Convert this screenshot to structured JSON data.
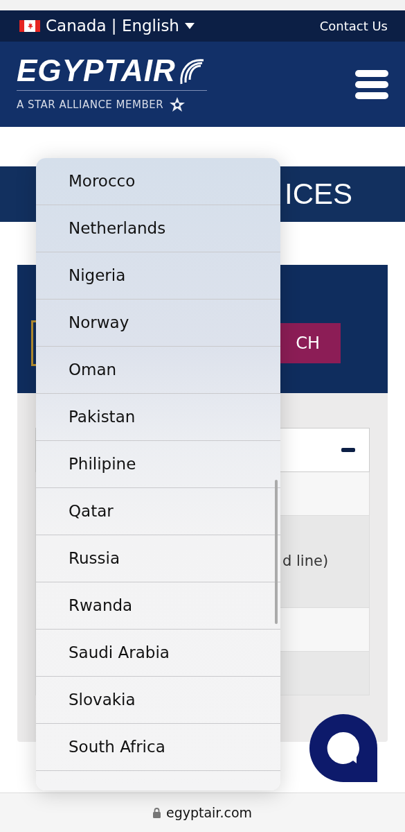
{
  "top_bar": {
    "locale": "Canada | English",
    "contact": "Contact Us"
  },
  "header": {
    "logo_text": "EGYPTAIR",
    "tagline": "A STAR ALLIANCE MEMBER"
  },
  "title_band": {
    "text_right": "ICES"
  },
  "search_panel": {
    "button": "CH"
  },
  "results": {
    "row_text": "d line)"
  },
  "country_picker": {
    "options": [
      {
        "label": "Morocco",
        "selected": false
      },
      {
        "label": "Netherlands",
        "selected": false
      },
      {
        "label": "Nigeria",
        "selected": false
      },
      {
        "label": "Norway",
        "selected": false
      },
      {
        "label": "Oman",
        "selected": false
      },
      {
        "label": "Pakistan",
        "selected": false
      },
      {
        "label": "Philipine",
        "selected": false
      },
      {
        "label": "Qatar",
        "selected": false
      },
      {
        "label": "Russia",
        "selected": false
      },
      {
        "label": "Rwanda",
        "selected": false
      },
      {
        "label": "Saudi Arabia",
        "selected": false
      },
      {
        "label": "Slovakia",
        "selected": false
      },
      {
        "label": "South Africa",
        "selected": false
      }
    ]
  },
  "browser": {
    "url": "egyptair.com"
  }
}
